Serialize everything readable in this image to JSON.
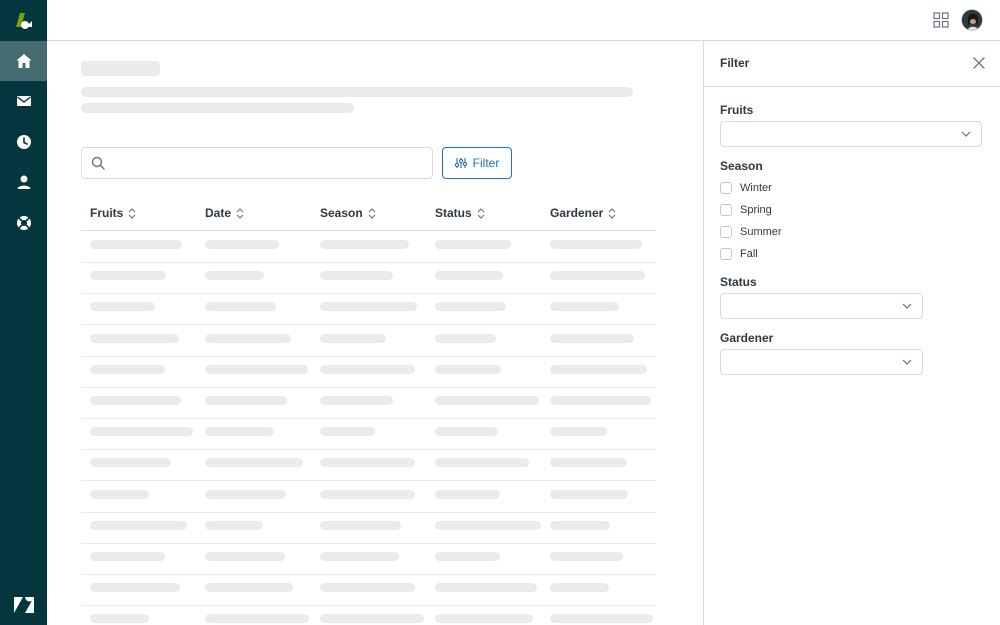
{
  "nav": {
    "items": [
      {
        "name": "home",
        "icon": "home-icon",
        "active": true
      },
      {
        "name": "mail",
        "icon": "mail-icon",
        "active": false
      },
      {
        "name": "clock",
        "icon": "clock-icon",
        "active": false
      },
      {
        "name": "user",
        "icon": "user-icon",
        "active": false
      },
      {
        "name": "support",
        "icon": "lifebuoy-icon",
        "active": false
      }
    ],
    "logo_icon": "brand-logo-icon",
    "footer_icon": "zendesk-logo-icon"
  },
  "header": {
    "apps_icon": "grid-icon",
    "avatar": "user-avatar"
  },
  "main": {
    "search": {
      "placeholder": "",
      "value": ""
    },
    "filter_button": {
      "label": "Filter",
      "icon": "sliders-icon"
    },
    "table": {
      "columns": [
        "Fruits",
        "Date",
        "Season",
        "Status",
        "Gardener"
      ],
      "rows_loading": 13
    }
  },
  "panel": {
    "title": "Filter",
    "close_icon": "close-icon",
    "fruits": {
      "label": "Fruits",
      "value": ""
    },
    "season": {
      "label": "Season",
      "options": [
        "Winter",
        "Spring",
        "Summer",
        "Fall"
      ]
    },
    "status": {
      "label": "Status",
      "value": ""
    },
    "gardener": {
      "label": "Gardener",
      "value": ""
    }
  },
  "colors": {
    "nav_bg": "#03363d",
    "nav_active": "#466b70",
    "accent": "#1f73b7",
    "brand_green": "#78a300",
    "skeleton": "#e9ebed",
    "border": "#d8dcde"
  }
}
